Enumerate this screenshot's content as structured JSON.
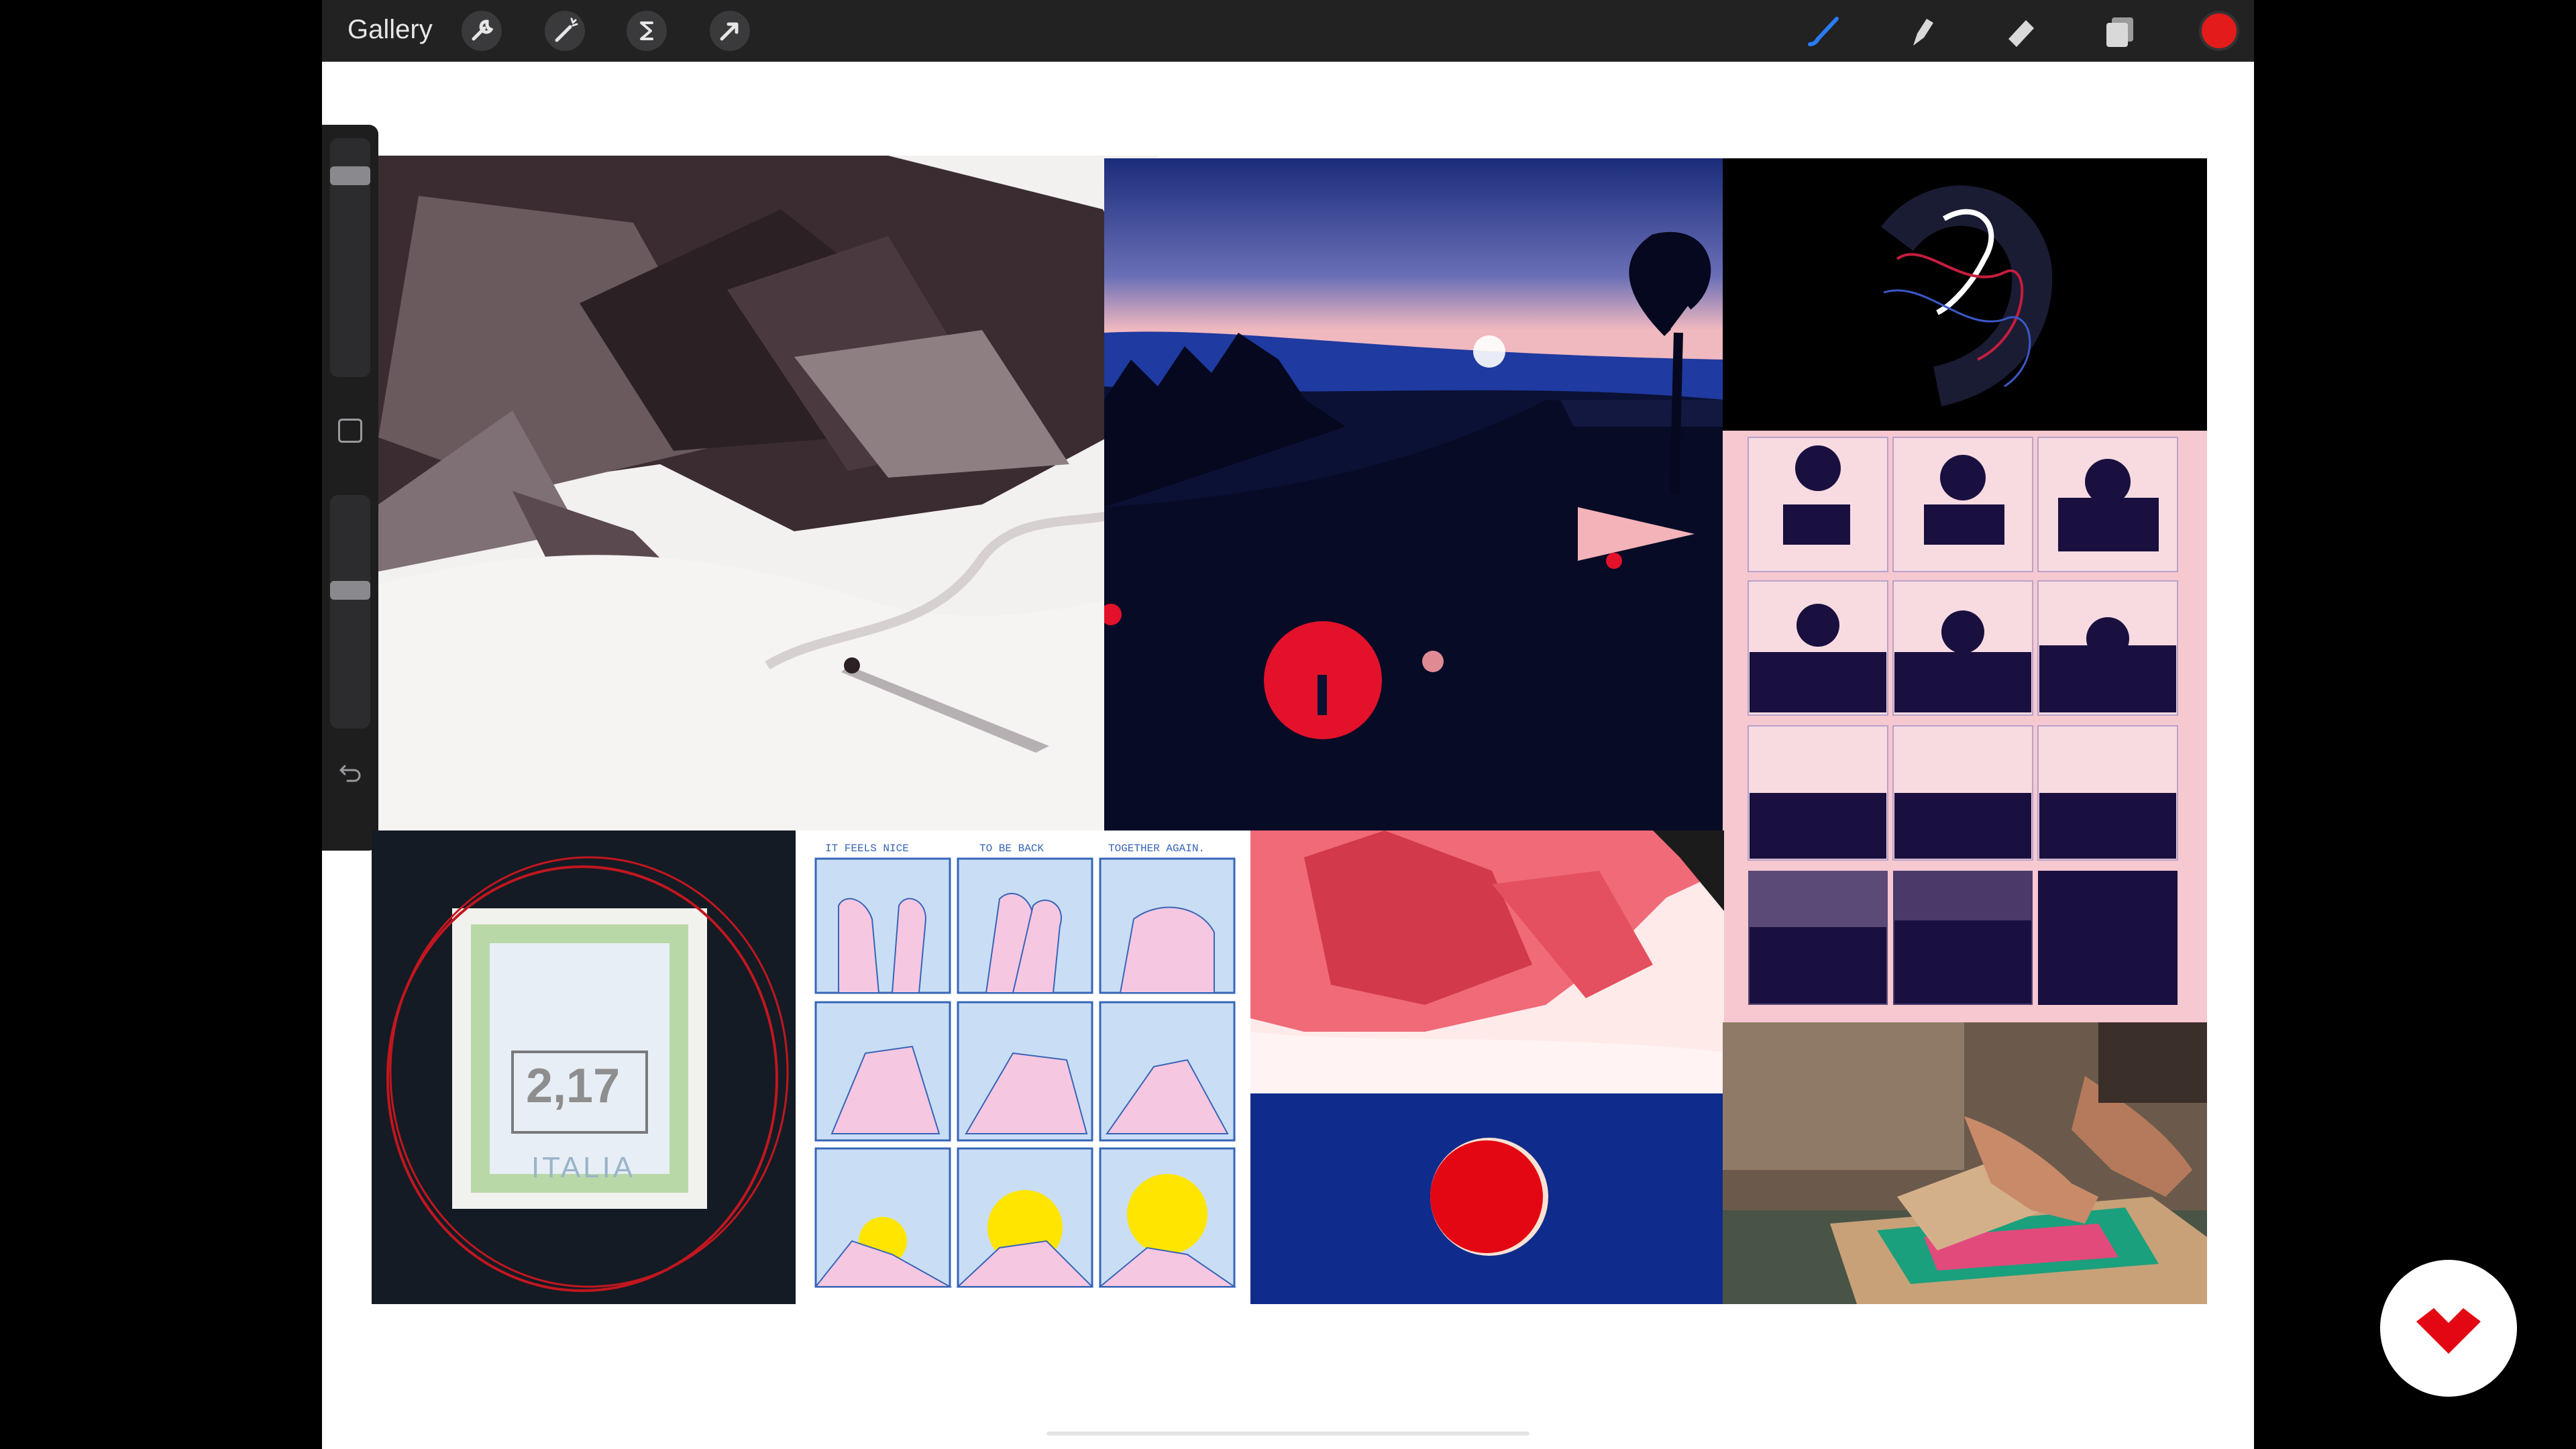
{
  "toolbar": {
    "gallery_label": "Gallery",
    "left_icons": [
      "wrench-icon",
      "magic-wand-icon",
      "selection-s-icon",
      "transform-arrow-icon"
    ],
    "right_icons": [
      "brush-icon",
      "smudge-icon",
      "eraser-icon",
      "layers-icon"
    ],
    "current_color": "#e31b1b"
  },
  "sidebar": {
    "brush_size_level": 0.9,
    "opacity_level": 0.6
  },
  "artworks": [
    {
      "name": "mountain-pyramid-illustration",
      "palette": [
        "#f2efef",
        "#3a2b2f"
      ]
    },
    {
      "name": "coastal-night-city-illustration",
      "palette": [
        "#0f1a4e",
        "#e3112a"
      ]
    },
    {
      "name": "scribble-head-sketch",
      "palette": [
        "#000000",
        "#ffffff"
      ]
    },
    {
      "name": "sunset-sea-sequence-grid",
      "palette": [
        "#f6c8d0",
        "#1a1040"
      ]
    },
    {
      "name": "italia-stamp-photo",
      "stamp_text": "ITALIA",
      "stamp_value": "2,17"
    },
    {
      "name": "hands-comic-panels",
      "captions": [
        "IT FEELS NICE",
        "TO BE BACK",
        "TOGETHER AGAIN."
      ]
    },
    {
      "name": "red-rock-landscape",
      "palette": [
        "#ef4a5a",
        "#ffe4e4"
      ]
    },
    {
      "name": "red-circle-on-blue",
      "palette": [
        "#0f2c8c",
        "#e30613"
      ]
    },
    {
      "name": "screen-printing-photo",
      "palette": [
        "#c7a37a",
        "#1aa07c"
      ]
    }
  ],
  "brand": {
    "color": "#e30613"
  }
}
